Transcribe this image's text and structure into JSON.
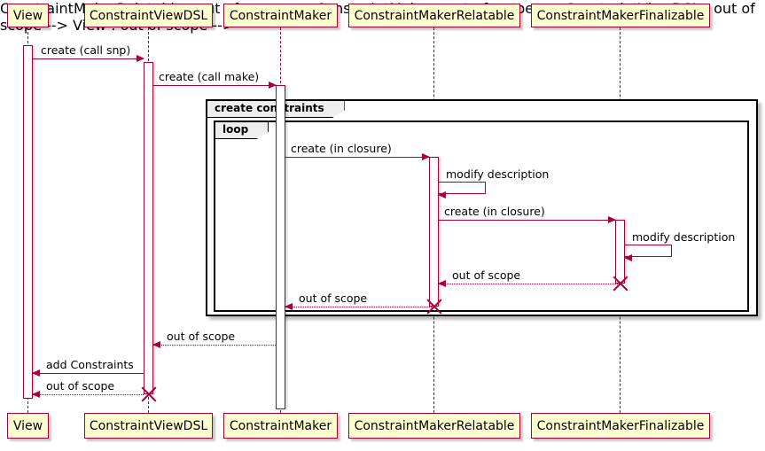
{
  "diagram": {
    "type": "sequence-diagram",
    "title": "",
    "colors": {
      "participant_fill": "#FEFECE",
      "participant_border": "#A80036",
      "arrow": "#A80036",
      "lifeline": "#A80036",
      "frame_border": "#000000",
      "frame_label_fill": "#EEEEEE"
    }
  },
  "participants": [
    {
      "id": "view",
      "label": "View"
    },
    {
      "id": "dsl",
      "label": "ConstraintViewDSL"
    },
    {
      "id": "maker",
      "label": "ConstraintMaker"
    },
    {
      "id": "relatable",
      "label": "ConstraintMakerRelatable"
    },
    {
      "id": "finalizable",
      "label": "ConstraintMakerFinalizable"
    }
  ],
  "frames": [
    {
      "id": "group",
      "label": "create constraints"
    },
    {
      "id": "loop",
      "label": "loop"
    }
  ],
  "messages": [
    {
      "id": "m1",
      "label": "create (call snp)",
      "from": "view",
      "to": "dsl",
      "style": "solid"
    },
    {
      "id": "m2",
      "label": "create (call make)",
      "from": "dsl",
      "to": "maker",
      "style": "solid"
    },
    {
      "id": "m3",
      "label": "create (in closure)",
      "from": "maker",
      "to": "relatable",
      "style": "solid"
    },
    {
      "id": "m4",
      "label": "modify description",
      "from": "relatable",
      "to": "relatable",
      "style": "self"
    },
    {
      "id": "m5",
      "label": "create (in closure)",
      "from": "relatable",
      "to": "finalizable",
      "style": "solid"
    },
    {
      "id": "m6",
      "label": "modify description",
      "from": "finalizable",
      "to": "finalizable",
      "style": "self"
    },
    {
      "id": "m7",
      "label": "out of scope",
      "from": "finalizable",
      "to": "relatable",
      "style": "dotted"
    },
    {
      "id": "m8",
      "label": "out of scope",
      "from": "relatable",
      "to": "maker",
      "style": "dotted"
    },
    {
      "id": "m9",
      "label": "out of scope",
      "from": "maker",
      "to": "dsl",
      "style": "dotted"
    },
    {
      "id": "m10",
      "label": "add Constraints",
      "from": "dsl",
      "to": "view",
      "style": "solid"
    },
    {
      "id": "m11",
      "label": "out of scope",
      "from": "dsl",
      "to": "view",
      "style": "dotted"
    }
  ],
  "destroys": [
    {
      "id": "d-finalizable",
      "participant": "finalizable"
    },
    {
      "id": "d-relatable",
      "participant": "relatable"
    },
    {
      "id": "d-dsl",
      "participant": "dsl"
    }
  ]
}
